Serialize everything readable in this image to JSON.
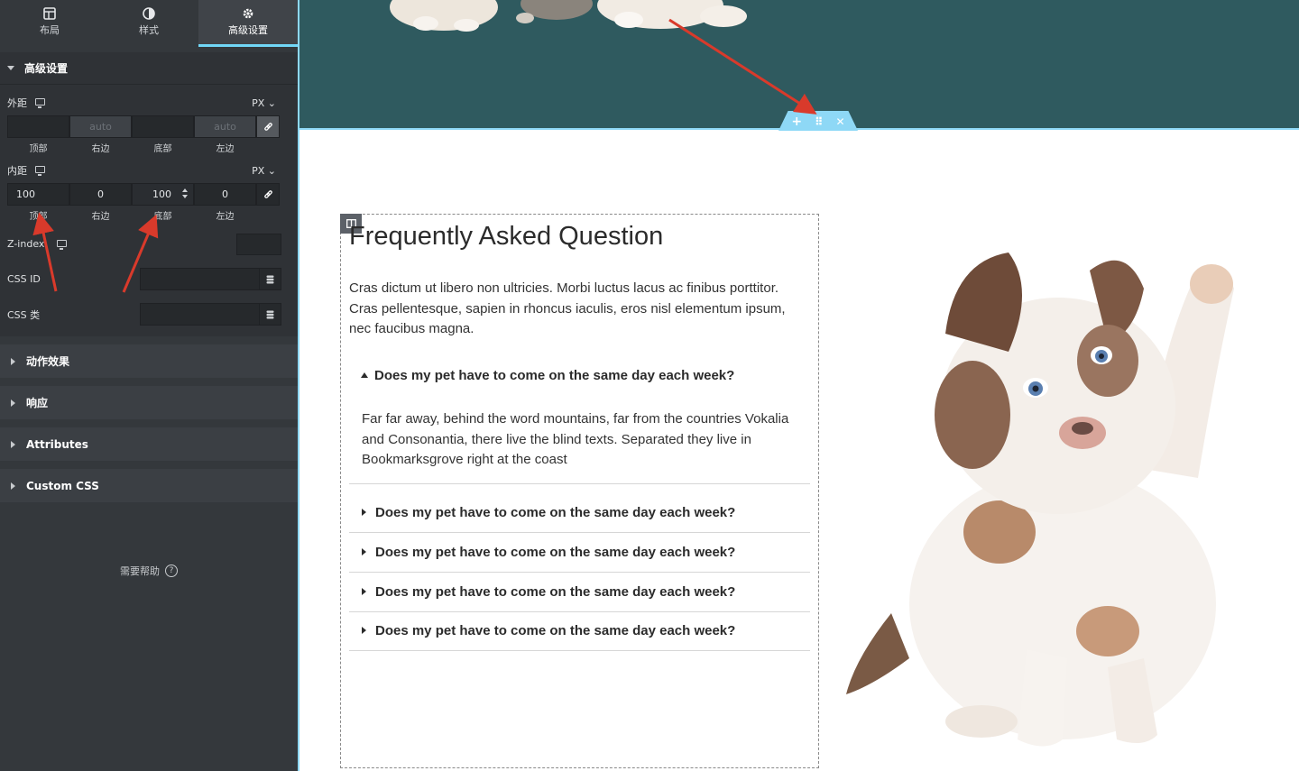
{
  "sidebar": {
    "tabs": [
      {
        "label": "布局",
        "icon": "layout-icon"
      },
      {
        "label": "样式",
        "icon": "contrast-icon"
      },
      {
        "label": "高级设置",
        "icon": "gear-icon"
      }
    ],
    "advanced_section": {
      "title": "高级设置",
      "margin": {
        "label": "外距",
        "unit": "PX",
        "fields": [
          {
            "label": "顶部",
            "value": ""
          },
          {
            "label": "右边",
            "value": "auto"
          },
          {
            "label": "底部",
            "value": ""
          },
          {
            "label": "左边",
            "value": "auto"
          }
        ]
      },
      "padding": {
        "label": "内距",
        "unit": "PX",
        "fields": [
          {
            "label": "顶部",
            "value": "100"
          },
          {
            "label": "右边",
            "value": "0"
          },
          {
            "label": "底部",
            "value": "100"
          },
          {
            "label": "左边",
            "value": "0"
          }
        ]
      },
      "zindex_label": "Z-index",
      "css_id_label": "CSS ID",
      "css_class_label": "CSS 类"
    },
    "sections": [
      "动作效果",
      "响应",
      "Attributes",
      "Custom CSS"
    ],
    "help_text": "需要帮助",
    "help_icon_glyph": "?"
  },
  "canvas": {
    "handle_icons": {
      "add": "+",
      "move": "⠿",
      "close": "✕"
    },
    "faq": {
      "title": "Frequently Asked Question",
      "intro": "Cras dictum ut libero non ultricies. Morbi luctus lacus ac finibus porttitor. Cras pellentesque, sapien in rhoncus iaculis, eros nisl elementum ipsum, nec faucibus magna.",
      "items": [
        {
          "question": "Does my pet have to come on the same day each week?",
          "open": true,
          "answer": "Far far away, behind the word mountains, far from the countries Vokalia and Consonantia, there live the blind texts. Separated they live in Bookmarksgrove right at the coast"
        },
        {
          "question": "Does my pet have to come on the same day each week?",
          "open": false
        },
        {
          "question": "Does my pet have to come on the same day each week?",
          "open": false
        },
        {
          "question": "Does my pet have to come on the same day each week?",
          "open": false
        },
        {
          "question": "Does my pet have to come on the same day each week?",
          "open": false
        }
      ]
    }
  },
  "colors": {
    "panel_bg": "#34383c",
    "accent": "#71d7f7",
    "band": "#2f5a5f",
    "annotation_arrow": "#d93a2b"
  }
}
